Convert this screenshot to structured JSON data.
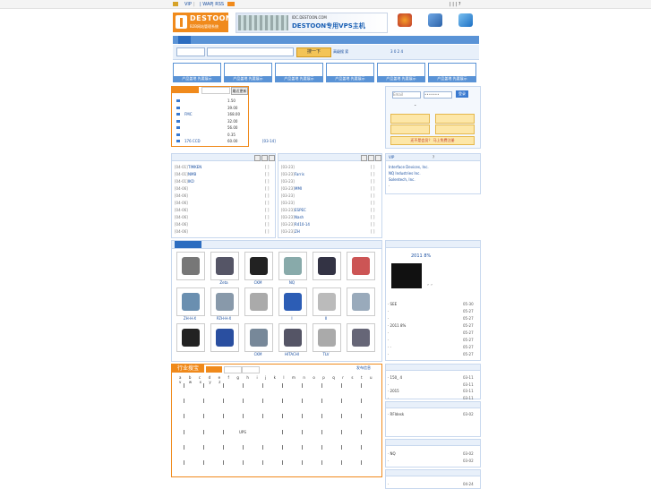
{
  "topbar": {
    "vip": "VIP",
    "sep1": "|",
    "wap": "| WAP",
    "rss": "| RSS",
    "right": "|    |    |    ?"
  },
  "logo": {
    "brand": "DESTOON",
    "sub": "B2B网站管理系统"
  },
  "banner": {
    "domain": "IDC.DESTOON.COM",
    "headline": "DESTOON专用VPS主机"
  },
  "search": {
    "button": "搜一下",
    "hot_label": "高级搜",
    "hot_val": "索",
    "version": "3  0  2  4"
  },
  "ads": [
    "产品盖地  先要展示",
    "产品盖地  先要展示",
    "产品盖地  先要展示",
    "产品盖地  先要展示",
    "产品盖地  先要展示",
    "产品盖地  先要展示"
  ],
  "price_panel": {
    "button": "最近更新",
    "rows": [
      {
        "name": "",
        "price": "1.50"
      },
      {
        "name": "",
        "price": "39.00"
      },
      {
        "name": "FMC",
        "price": "168.00"
      },
      {
        "name": "",
        "price": "32.00"
      },
      {
        "name": "",
        "price": "56.00"
      },
      {
        "name": "",
        "price": "0.35"
      },
      {
        "name": "176    CCD",
        "price": "60.00"
      }
    ],
    "tag": "[03-14]"
  },
  "login": {
    "email": "Email",
    "pass": "•••••••",
    "btn": "登录",
    "notice": "还不是会员？  马上免费注册"
  },
  "vip_panel": {
    "tab1": "VIP",
    "tab2": "?",
    "items": [
      "Interface Devices, Inc.",
      "NQ Industries Inc.",
      "Solentech, Inc."
    ]
  },
  "list_left": [
    {
      "date": "[04-01]",
      "name": "TIMKEN"
    },
    {
      "date": "[04-01]",
      "name": "    NMB"
    },
    {
      "date": "[04-01]",
      "name": " IKO"
    },
    {
      "date": "[04-06]",
      "name": ""
    },
    {
      "date": "[04-06]",
      "name": ""
    },
    {
      "date": "[04-06]",
      "name": ""
    },
    {
      "date": "[04-06]",
      "name": ""
    },
    {
      "date": "[04-06]",
      "name": ""
    },
    {
      "date": "[04-06]",
      "name": ""
    },
    {
      "date": "[04-06]",
      "name": ""
    }
  ],
  "list_right": [
    {
      "date": "[03-23]",
      "name": ""
    },
    {
      "date": "[03-23]",
      "name": " Farris"
    },
    {
      "date": "[03-23]",
      "name": ""
    },
    {
      "date": "[03-23]",
      "name": "    MMI"
    },
    {
      "date": "[03-23]",
      "name": ""
    },
    {
      "date": "[03-23]",
      "name": ""
    },
    {
      "date": "[03-23]",
      "name": " ESPEC"
    },
    {
      "date": "[03-23]",
      "name": " Nash"
    },
    {
      "date": "[03-23]",
      "name": "    R410-14"
    },
    {
      "date": "[03-23]",
      "name": "    ZH"
    }
  ],
  "products": [
    {
      "label": ""
    },
    {
      "label": "Zeta"
    },
    {
      "label": "CKM"
    },
    {
      "label": "NQ"
    },
    {
      "label": ""
    },
    {
      "label": ""
    },
    {
      "label": "ZH-H-X"
    },
    {
      "label": "PZH-H-X"
    },
    {
      "label": ""
    },
    {
      "label": "I"
    },
    {
      "label": "II"
    },
    {
      "label": ""
    },
    {
      "label": ""
    },
    {
      "label": ""
    },
    {
      "label": "CKM"
    },
    {
      "label": "HITACHI"
    },
    {
      "label": "TLV"
    },
    {
      "label": ""
    }
  ],
  "news_right": {
    "head": "2011           8%",
    "caption": "，，",
    "items": [
      {
        "t": "·  SEE",
        "d": "05-30"
      },
      {
        "t": "·",
        "d": "05-27"
      },
      {
        "t": "·",
        "d": "05-27"
      },
      {
        "t": "·  2011       8%",
        "d": "05-27"
      },
      {
        "t": "·",
        "d": "05-27"
      },
      {
        "t": "·",
        "d": "05-27"
      },
      {
        "t": "·     ·",
        "d": "05-27"
      },
      {
        "t": "·",
        "d": "05-27"
      }
    ]
  },
  "industry": {
    "title": "行业搜宝",
    "publish": "发布信息",
    "letters": "a b c d e f g h i j k l m n o p q r s t u v w x y z",
    "mid": "UPS"
  },
  "right_small": [
    {
      "t": "·  150_ 4",
      "d": "03-11"
    },
    {
      "t": "·",
      "d": "03-11"
    },
    {
      "t": "·  2015",
      "d": "03-11"
    },
    {
      "t": "·",
      "d": "03-11"
    },
    {
      "t": "·  RFIdesk",
      "d": "03-02"
    },
    {
      "t": "·  NQ",
      "d": "03-02"
    },
    {
      "t": "·",
      "d": "03-02"
    },
    {
      "t": "·",
      "d": "04-24"
    }
  ],
  "colors": {
    "accent": "#f08a1c",
    "nav": "#5a93d6",
    "link": "#1a4fa0"
  }
}
